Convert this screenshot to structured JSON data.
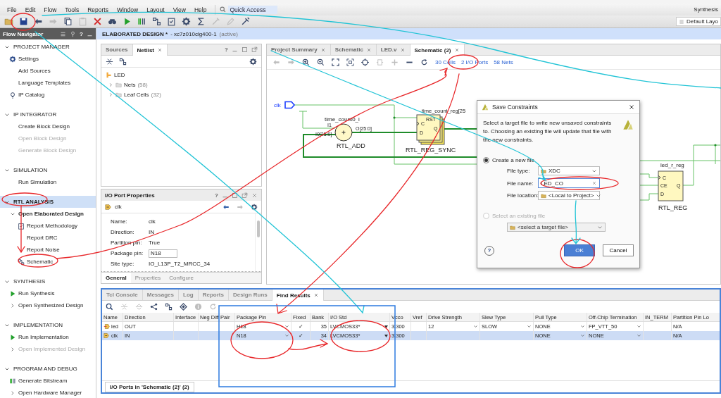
{
  "menu_bar": {
    "menus": [
      "File",
      "Edit",
      "Flow",
      "Tools",
      "Reports",
      "Window",
      "Layout",
      "View",
      "Help"
    ],
    "quick_access": {
      "placeholder": "Quick Access"
    },
    "status": "Synthesis"
  },
  "toolbar": {
    "buttons": [
      {
        "kind": "folder",
        "disabled": false
      },
      {
        "kind": "save",
        "disabled": false
      },
      {
        "kind": "undo",
        "disabled": false
      },
      {
        "kind": "redo",
        "disabled": true
      },
      {
        "kind": "copy",
        "disabled": false
      },
      {
        "kind": "paste",
        "disabled": true
      },
      {
        "kind": "delete",
        "disabled": false
      },
      {
        "kind": "binoculars",
        "disabled": false
      },
      {
        "kind": "play",
        "disabled": false
      },
      {
        "kind": "bars",
        "disabled": false
      },
      {
        "kind": "schematic",
        "disabled": false
      },
      {
        "kind": "clipboard",
        "disabled": false
      },
      {
        "kind": "gear",
        "disabled": false
      },
      {
        "kind": "sigma",
        "disabled": false
      },
      {
        "kind": "wand",
        "disabled": true
      },
      {
        "kind": "pencil",
        "disabled": true
      },
      {
        "kind": "probe",
        "disabled": false
      }
    ],
    "layout_button": "Default Layo"
  },
  "flow_navigator": {
    "title": "Flow Navigator",
    "help": "?",
    "sections": [
      {
        "title": "PROJECT MANAGER",
        "expanded": true,
        "selected": false,
        "items": [
          {
            "label": "Settings",
            "kind": "settings",
            "disabled": false
          },
          {
            "label": "Add Sources",
            "kind": "text",
            "disabled": false
          },
          {
            "label": "Language Templates",
            "kind": "text",
            "disabled": false
          },
          {
            "label": "IP Catalog",
            "kind": "catalog",
            "disabled": false
          }
        ]
      },
      {
        "title": "IP INTEGRATOR",
        "expanded": true,
        "selected": false,
        "items": [
          {
            "label": "Create Block Design",
            "kind": "text",
            "disabled": false
          },
          {
            "label": "Open Block Design",
            "kind": "text",
            "disabled": true
          },
          {
            "label": "Generate Block Design",
            "kind": "text",
            "disabled": true
          }
        ]
      },
      {
        "title": "SIMULATION",
        "expanded": true,
        "selected": false,
        "items": [
          {
            "label": "Run Simulation",
            "kind": "text",
            "disabled": false
          }
        ]
      },
      {
        "title": "RTL ANALYSIS",
        "expanded": true,
        "selected": true,
        "items": [
          {
            "label": "Open Elaborated Design",
            "disabled": false,
            "expanded": true,
            "children": [
              {
                "label": "Report Methodology",
                "kind": "report",
                "disabled": false
              },
              {
                "label": "Report DRC",
                "kind": "text",
                "disabled": false
              },
              {
                "label": "Report Noise",
                "kind": "text",
                "disabled": false
              },
              {
                "label": "Schematic",
                "kind": "schematic",
                "disabled": false
              }
            ]
          }
        ]
      },
      {
        "title": "SYNTHESIS",
        "expanded": true,
        "selected": false,
        "items": [
          {
            "label": "Run Synthesis",
            "kind": "run",
            "disabled": false
          },
          {
            "label": "Open Synthesized Design",
            "disabled": false,
            "expanded": false
          }
        ]
      },
      {
        "title": "IMPLEMENTATION",
        "expanded": true,
        "selected": false,
        "items": [
          {
            "label": "Run Implementation",
            "kind": "run",
            "disabled": false
          },
          {
            "label": "Open Implemented Design",
            "disabled": true,
            "expanded": false
          }
        ]
      },
      {
        "title": "PROGRAM AND DEBUG",
        "expanded": true,
        "selected": false,
        "items": [
          {
            "label": "Generate Bitstream",
            "kind": "bitstream",
            "disabled": false
          },
          {
            "label": "Open Hardware Manager",
            "disabled": false,
            "expanded": false
          }
        ]
      }
    ]
  },
  "design_header": {
    "title": "ELABORATED DESIGN *",
    "part": "- xc7z010clg400-1",
    "status": "(active)"
  },
  "netlist_panel": {
    "tabs": [
      {
        "label": "Sources",
        "selected": false,
        "closable": false
      },
      {
        "label": "Netlist",
        "selected": true,
        "closable": true
      }
    ],
    "help": "?",
    "tree": [
      {
        "label": "LED",
        "children": [
          {
            "label": "Nets",
            "count": "(58)",
            "expanded": false
          },
          {
            "label": "Leaf Cells",
            "count": "(32)",
            "expanded": false
          }
        ]
      }
    ]
  },
  "properties_panel": {
    "title": "I/O Port Properties",
    "help": "?",
    "object": "clk",
    "properties": [
      {
        "label": "Name:",
        "value": "clk",
        "kind": "text"
      },
      {
        "label": "Direction:",
        "value": "IN",
        "kind": "text"
      },
      {
        "label": "Partition pin:",
        "value": "True",
        "kind": "text"
      },
      {
        "label": "Package pin:",
        "value": "N18",
        "kind": "field"
      },
      {
        "label": "Site type:",
        "value": "IO_L13P_T2_MRCC_34",
        "kind": "text"
      }
    ],
    "tabs": [
      {
        "label": "General",
        "selected": true
      },
      {
        "label": "Properties",
        "selected": false
      },
      {
        "label": "Configure",
        "selected": false
      }
    ]
  },
  "schematic_panel": {
    "tabs": [
      {
        "label": "Project Summary",
        "selected": false
      },
      {
        "label": "Schematic",
        "selected": false
      },
      {
        "label": "LED.v",
        "selected": false
      },
      {
        "label": "Schematic (2)",
        "selected": true
      }
    ],
    "toolbar": [
      {
        "kind": "back",
        "disabled": true
      },
      {
        "kind": "forward",
        "disabled": true
      },
      {
        "kind": "zoom-in",
        "disabled": false
      },
      {
        "kind": "zoom-out",
        "disabled": false
      },
      {
        "kind": "fit",
        "disabled": false
      },
      {
        "kind": "fit-selection",
        "disabled": false
      },
      {
        "kind": "target",
        "disabled": false
      },
      {
        "kind": "route",
        "disabled": true
      },
      {
        "kind": "plus",
        "disabled": true
      },
      {
        "kind": "minus",
        "disabled": false
      },
      {
        "kind": "refresh",
        "disabled": false
      }
    ],
    "links": [
      "30 Cells",
      "2 I/O Ports",
      "58 Nets"
    ],
    "diagram": {
      "ports": [
        {
          "label": "clk"
        }
      ],
      "cells": [
        {
          "kind": "adder",
          "instance": "time_count0_i",
          "type": "RTL_ADD",
          "pins": [
            "I1",
            "I0[25:0]",
            "O[25:0]"
          ]
        },
        {
          "kind": "register-stack",
          "instance": "time_count_reg[25",
          "type": "RTL_REG_SYNC",
          "pins": [
            "RST",
            "C",
            "D",
            "Q"
          ]
        },
        {
          "kind": "register",
          "instance": "led_r_reg",
          "type": "RTL_REG",
          "pins": [
            "C",
            "CE",
            "D",
            "Q"
          ]
        }
      ]
    }
  },
  "dialog": {
    "title": "Save Constraints",
    "description": "Select a target file to write new unsaved constraints to. Choosing an existing file will update that file with the new constraints.",
    "options": [
      {
        "label": "Create a new file",
        "selected": true,
        "disabled": false,
        "fields": [
          {
            "label": "File type:",
            "value": "XDC",
            "kind": "dropdown"
          },
          {
            "label": "File name:",
            "value": "LED_CO",
            "kind": "text"
          },
          {
            "label": "File location:",
            "value": "<Local to Project>",
            "kind": "dropdown"
          }
        ]
      },
      {
        "label": "Select an existing file",
        "selected": false,
        "disabled": true,
        "fields": [
          {
            "value": "<select a target file>",
            "kind": "dropdown"
          }
        ]
      }
    ],
    "help": "?",
    "buttons": [
      {
        "label": "OK",
        "kind": "primary"
      },
      {
        "label": "Cancel",
        "kind": "normal"
      }
    ]
  },
  "bottom_panel": {
    "tabs": [
      {
        "label": "Tcl Console",
        "selected": false
      },
      {
        "label": "Messages",
        "selected": false
      },
      {
        "label": "Log",
        "selected": false
      },
      {
        "label": "Reports",
        "selected": false
      },
      {
        "label": "Design Runs",
        "selected": false
      },
      {
        "label": "Find Results",
        "selected": true
      }
    ],
    "toolbar": [
      {
        "kind": "search",
        "disabled": false
      },
      {
        "kind": "collapse",
        "disabled": true
      },
      {
        "kind": "expand",
        "disabled": true
      },
      {
        "kind": "hierarchy",
        "disabled": false
      },
      {
        "kind": "schematic",
        "disabled": false
      },
      {
        "kind": "diamond",
        "disabled": false
      },
      {
        "kind": "info",
        "disabled": true
      },
      {
        "kind": "refresh",
        "disabled": true
      }
    ],
    "table": {
      "columns": [
        {
          "label": "Name",
          "kind": "name"
        },
        {
          "label": "Direction",
          "kind": "text"
        },
        {
          "label": "Interface"
        },
        {
          "label": "Neg Diff Pair"
        },
        {
          "label": "Package Pin",
          "kind": "dropdown"
        },
        {
          "label": "Fixed",
          "kind": "check"
        },
        {
          "label": "Bank",
          "kind": "number"
        },
        {
          "label": "I/O Std",
          "kind": "menu"
        },
        {
          "label": "Vcco",
          "kind": "text"
        },
        {
          "label": "Vref"
        },
        {
          "label": "Drive Strength",
          "kind": "dropdown"
        },
        {
          "label": "Slew Type",
          "kind": "dropdown"
        },
        {
          "label": "Pull Type",
          "kind": "dropdown"
        },
        {
          "label": "Off-Chip Termination",
          "kind": "dropdown"
        },
        {
          "label": "IN_TERM"
        },
        {
          "label": "Partition Pin Lo",
          "kind": "text"
        }
      ],
      "rows": [
        {
          "kind": "output",
          "selected": false,
          "cells": [
            "led",
            "OUT",
            null,
            null,
            "H18",
            "✓",
            "35",
            "LVCMOS33*",
            "3.300",
            null,
            "12",
            "SLOW",
            "NONE",
            "FP_VTT_50",
            null,
            "N/A"
          ]
        },
        {
          "kind": "input",
          "selected": true,
          "cells": [
            "clk",
            "IN",
            null,
            null,
            "N18",
            "✓",
            "34",
            "LVCMOS33*",
            "3.300",
            null,
            null,
            null,
            "NONE",
            "NONE",
            null,
            "N/A"
          ]
        }
      ]
    },
    "footer_tab": "I/O Ports in 'Schematic (2)' (2)"
  }
}
